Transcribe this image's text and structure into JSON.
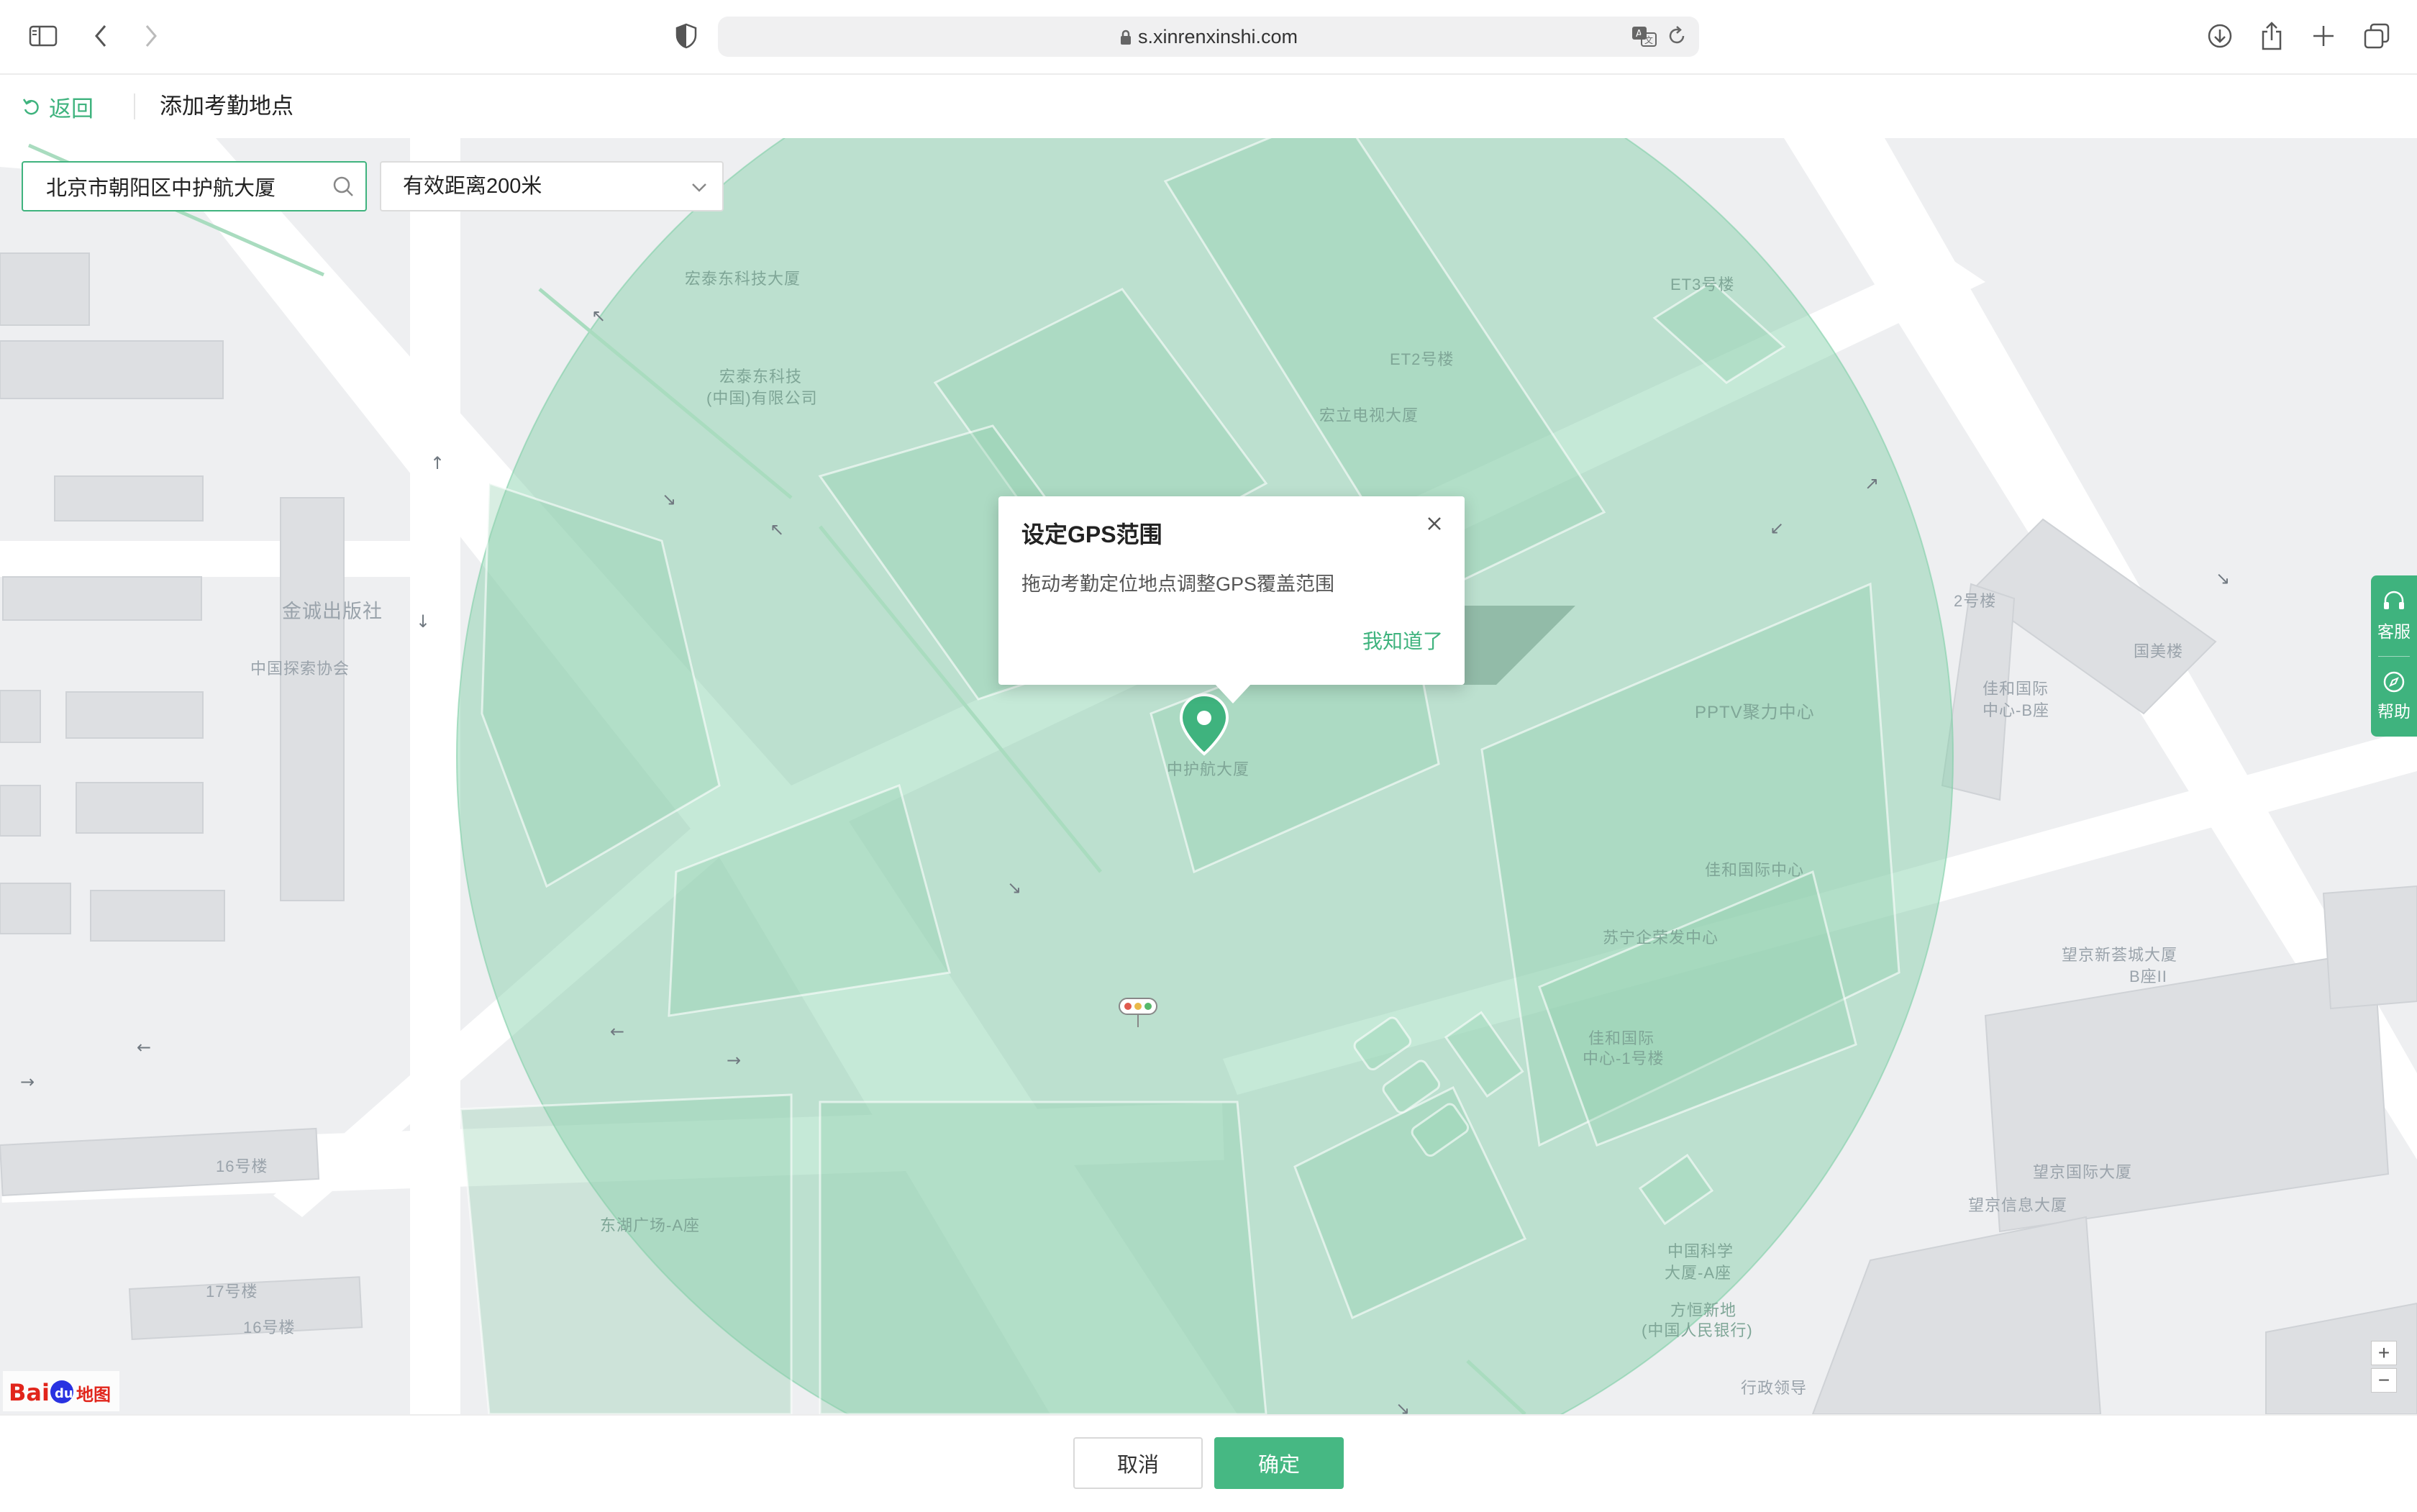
{
  "browser": {
    "url": "s.xinrenxinshi.com",
    "icons": [
      "sidebar-icon",
      "back-icon",
      "forward-icon",
      "shield-icon",
      "lock-icon",
      "translate-icon",
      "reload-icon",
      "download-icon",
      "share-icon",
      "new-tab-icon",
      "tabs-overview-icon"
    ]
  },
  "header": {
    "back_label": "返回",
    "title": "添加考勤地点"
  },
  "search": {
    "value": "北京市朝阳区中护航大厦",
    "placeholder": ""
  },
  "range_select": {
    "selected": "有效距离200米"
  },
  "popover": {
    "title": "设定GPS范围",
    "description": "拖动考勤定位地点调整GPS覆盖范围",
    "ok_label": "我知道了"
  },
  "map": {
    "accent": "#3fb37e",
    "circle_fill": "#7fcfa6",
    "labels": {
      "l1": "宏泰东科技大厦",
      "l2": "宏泰东科技",
      "l3": "(中国)有限公司",
      "l4": "ET3号楼",
      "l5": "ET2号楼",
      "l6": "宏立电视大厦",
      "l7": "金诚出版社",
      "l8": "中国探索协会",
      "l9": "中护航大厦",
      "l10": "2号楼",
      "l11": "国美楼",
      "l12": "佳和国际",
      "l13": "中心-B座",
      "l14": "PPTV聚力中心",
      "l15": "佳和国际中心",
      "l16": "苏宁企荣发中心",
      "l17": "佳和国际",
      "l18": "中心-1号楼",
      "l19": "望京新荟城大厦",
      "l20": "B座II",
      "l21": "16号楼",
      "l22": "17号楼",
      "l23": "16号楼",
      "l24": "东湖广场-A座",
      "l25": "中国科学",
      "l26": "大厦-A座",
      "l27": "方恒新地",
      "l28": "(中国人民银行)",
      "l29": "望京国际大厦",
      "l30": "望京信息大厦",
      "l31": "行政领导"
    },
    "baidu_logo": "Bai du 地图"
  },
  "side_tools": {
    "service_label": "客服",
    "help_label": "帮助"
  },
  "footer": {
    "cancel_label": "取消",
    "confirm_label": "确定"
  }
}
